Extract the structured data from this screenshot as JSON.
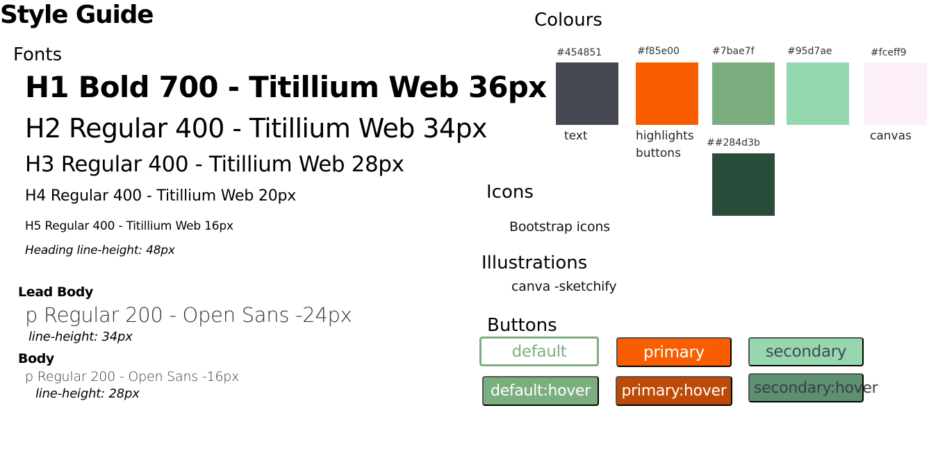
{
  "title": "Style Guide",
  "fonts": {
    "heading": "Fonts",
    "h1": "H1 Bold 700 - Titillium Web 36px",
    "h2": "H2 Regular 400 - Titillium Web 34px",
    "h3": "H3 Regular 400 - Titillium Web 28px",
    "h4": "H4 Regular 400 - Titillium Web 20px",
    "h5": "H5 Regular 400 - Titillium Web 16px",
    "heading_line_height": "Heading line-height: 48px",
    "lead_label": "Lead Body",
    "lead_sample": "p Regular 200 -  Open Sans -24px",
    "lead_line_height": "line-height: 34px",
    "body_label": "Body",
    "body_sample": "p Regular 200 -  Open Sans  -16px",
    "body_line_height": "line-height: 28px"
  },
  "colours": {
    "heading": "Colours",
    "swatches": [
      {
        "hex_label": "#454851",
        "color": "#454851",
        "caption": "text"
      },
      {
        "hex_label": "#f85e00",
        "color": "#f85e00",
        "caption": "highlights\nbuttons"
      },
      {
        "hex_label": "#7bae7f",
        "color": "#7bae7f",
        "caption": ""
      },
      {
        "hex_label": "#95d7ae",
        "color": "#95d7ae",
        "caption": ""
      },
      {
        "hex_label": "#fceff9",
        "color": "#fceff9",
        "caption": "canvas"
      },
      {
        "hex_label": "##284d3b",
        "color": "#284d3b",
        "caption": ""
      }
    ]
  },
  "icons": {
    "heading": "Icons",
    "value": "Bootstrap icons"
  },
  "illustrations": {
    "heading": "Illustrations",
    "value": "canva -sketchify"
  },
  "buttons": {
    "heading": "Buttons",
    "default": "default",
    "primary": "primary",
    "secondary": "secondary",
    "default_hover": "default:hover",
    "primary_hover": "primary:hover",
    "secondary_hover": "secondary:hover"
  }
}
